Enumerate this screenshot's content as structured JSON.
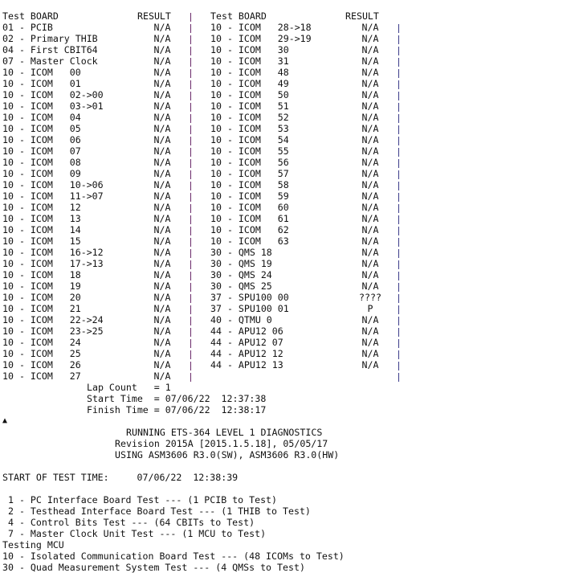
{
  "table": {
    "left": {
      "header_board": "Test BOARD",
      "header_result": "RESULT",
      "rows": [
        [
          "01 - PCIB",
          "N/A"
        ],
        [
          "02 - Primary THIB",
          "N/A"
        ],
        [
          "04 - First CBIT64",
          "N/A"
        ],
        [
          "07 - Master Clock",
          "N/A"
        ],
        [
          "10 - ICOM   00",
          "N/A"
        ],
        [
          "10 - ICOM   01",
          "N/A"
        ],
        [
          "10 - ICOM   02->00",
          "N/A"
        ],
        [
          "10 - ICOM   03->01",
          "N/A"
        ],
        [
          "10 - ICOM   04",
          "N/A"
        ],
        [
          "10 - ICOM   05",
          "N/A"
        ],
        [
          "10 - ICOM   06",
          "N/A"
        ],
        [
          "10 - ICOM   07",
          "N/A"
        ],
        [
          "10 - ICOM   08",
          "N/A"
        ],
        [
          "10 - ICOM   09",
          "N/A"
        ],
        [
          "10 - ICOM   10->06",
          "N/A"
        ],
        [
          "10 - ICOM   11->07",
          "N/A"
        ],
        [
          "10 - ICOM   12",
          "N/A"
        ],
        [
          "10 - ICOM   13",
          "N/A"
        ],
        [
          "10 - ICOM   14",
          "N/A"
        ],
        [
          "10 - ICOM   15",
          "N/A"
        ],
        [
          "10 - ICOM   16->12",
          "N/A"
        ],
        [
          "10 - ICOM   17->13",
          "N/A"
        ],
        [
          "10 - ICOM   18",
          "N/A"
        ],
        [
          "10 - ICOM   19",
          "N/A"
        ],
        [
          "10 - ICOM   20",
          "N/A"
        ],
        [
          "10 - ICOM   21",
          "N/A"
        ],
        [
          "10 - ICOM   22->24",
          "N/A"
        ],
        [
          "10 - ICOM   23->25",
          "N/A"
        ],
        [
          "10 - ICOM   24",
          "N/A"
        ],
        [
          "10 - ICOM   25",
          "N/A"
        ],
        [
          "10 - ICOM   26",
          "N/A"
        ],
        [
          "10 - ICOM   27",
          "N/A"
        ]
      ]
    },
    "right": {
      "header_board": "Test BOARD",
      "header_result": "RESULT",
      "rows": [
        [
          "10 - ICOM   28->18",
          "N/A"
        ],
        [
          "10 - ICOM   29->19",
          "N/A"
        ],
        [
          "10 - ICOM   30",
          "N/A"
        ],
        [
          "10 - ICOM   31",
          "N/A"
        ],
        [
          "10 - ICOM   48",
          "N/A"
        ],
        [
          "10 - ICOM   49",
          "N/A"
        ],
        [
          "10 - ICOM   50",
          "N/A"
        ],
        [
          "10 - ICOM   51",
          "N/A"
        ],
        [
          "10 - ICOM   52",
          "N/A"
        ],
        [
          "10 - ICOM   53",
          "N/A"
        ],
        [
          "10 - ICOM   54",
          "N/A"
        ],
        [
          "10 - ICOM   55",
          "N/A"
        ],
        [
          "10 - ICOM   56",
          "N/A"
        ],
        [
          "10 - ICOM   57",
          "N/A"
        ],
        [
          "10 - ICOM   58",
          "N/A"
        ],
        [
          "10 - ICOM   59",
          "N/A"
        ],
        [
          "10 - ICOM   60",
          "N/A"
        ],
        [
          "10 - ICOM   61",
          "N/A"
        ],
        [
          "10 - ICOM   62",
          "N/A"
        ],
        [
          "10 - ICOM   63",
          "N/A"
        ],
        [
          "30 - QMS 18",
          "N/A"
        ],
        [
          "30 - QMS 19",
          "N/A"
        ],
        [
          "30 - QMS 24",
          "N/A"
        ],
        [
          "30 - QMS 25",
          "N/A"
        ],
        [
          "37 - SPU100 00",
          "????"
        ],
        [
          "37 - SPU100 01",
          "P"
        ],
        [
          "40 - QTMU 0",
          "N/A"
        ],
        [
          "44 - APU12 06",
          "N/A"
        ],
        [
          "44 - APU12 07",
          "N/A"
        ],
        [
          "44 - APU12 12",
          "N/A"
        ],
        [
          "44 - APU12 13",
          "N/A"
        ]
      ]
    }
  },
  "summary": {
    "lap_count": "Lap Count   = 1",
    "start_time": "Start Time  = 07/06/22  12:37:38",
    "finish_time": "Finish Time = 07/06/22  12:38:17"
  },
  "cursor_icon": "up-arrow",
  "banner": {
    "line1": "RUNNING ETS-364 LEVEL 1 DIAGNOSTICS",
    "line2": "Revision 2015A [2015.1.5.18], 05/05/17",
    "line3": "USING ASM3606 R3.0(SW), ASM3606 R3.0(HW)"
  },
  "start_of_test": "START OF TEST TIME:     07/06/22  12:38:39",
  "log": [
    " 1 - PC Interface Board Test --- (1 PCIB to Test)",
    " 2 - Testhead Interface Board Test --- (1 THIB to Test)",
    " 4 - Control Bits Test --- (64 CBITs to Test)",
    " 7 - Master Clock Unit Test --- (1 MCU to Test)",
    "Testing MCU",
    "10 - Isolated Communication Board Test --- (48 ICOMs to Test)",
    "30 - Quad Measurement System Test --- (4 QMSs to Test)"
  ],
  "colors": {
    "left_divider": "#6b2a6b",
    "right_divider": "#3b3b8a",
    "text": "#111111"
  }
}
